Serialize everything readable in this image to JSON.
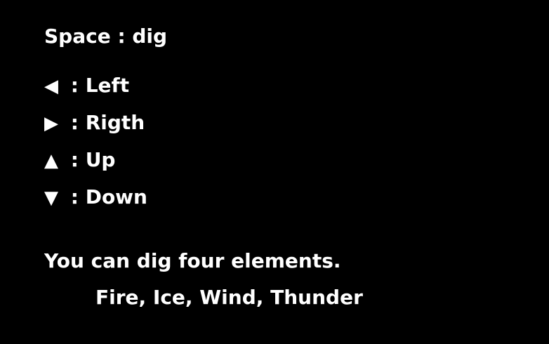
{
  "controls": {
    "dig": "Space : dig",
    "left": {
      "glyph": "◀",
      "label": ": Left"
    },
    "right": {
      "glyph": "▶",
      "label": ": Rigth"
    },
    "up": {
      "glyph": "▲",
      "label": ": Up"
    },
    "down": {
      "glyph": "▼",
      "label": ": Down"
    }
  },
  "info": {
    "intro": "You can dig four elements.",
    "elements": "Fire, Ice, Wind, Thunder"
  },
  "colors": {
    "background": "#000000",
    "text": "#ffffff"
  }
}
